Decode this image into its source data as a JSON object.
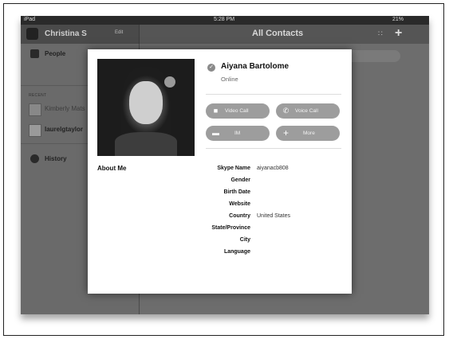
{
  "status_bar": {
    "device": "iPad",
    "time": "5:28 PM",
    "battery": "21%"
  },
  "header": {
    "user_name": "Christina S",
    "edit_label": "Edit",
    "title": "All Contacts"
  },
  "sidebar": {
    "people_label": "People",
    "recent_label": "RECENT",
    "recent": [
      {
        "name": "Kimberly Mats"
      },
      {
        "name": "laurelgtaylor"
      }
    ],
    "history_label": "History"
  },
  "profile": {
    "name": "Aiyana Bartolome",
    "presence": "Online",
    "about_label": "About Me",
    "buttons": {
      "video": "Video Call",
      "voice": "Voice Call",
      "im": "IM",
      "more": "More"
    },
    "fields": [
      {
        "label": "Skype Name",
        "value": "aiyanacb808"
      },
      {
        "label": "Gender",
        "value": ""
      },
      {
        "label": "Birth Date",
        "value": ""
      },
      {
        "label": "Website",
        "value": ""
      },
      {
        "label": "Country",
        "value": "United States"
      },
      {
        "label": "State/Province",
        "value": ""
      },
      {
        "label": "City",
        "value": ""
      },
      {
        "label": "Language",
        "value": ""
      }
    ]
  }
}
